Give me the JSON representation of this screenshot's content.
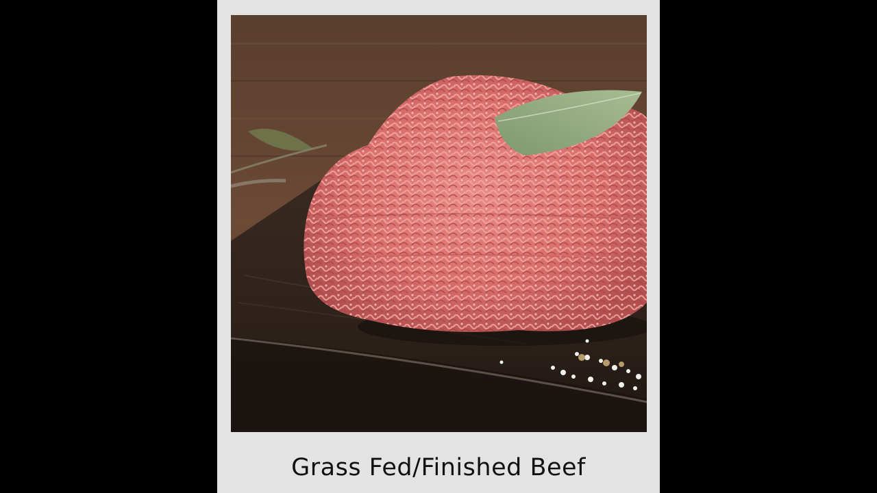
{
  "caption": "Grass Fed/Finished Beef",
  "colors": {
    "background": "#000000",
    "card": "#e3e3e3",
    "caption_text": "#111111"
  }
}
